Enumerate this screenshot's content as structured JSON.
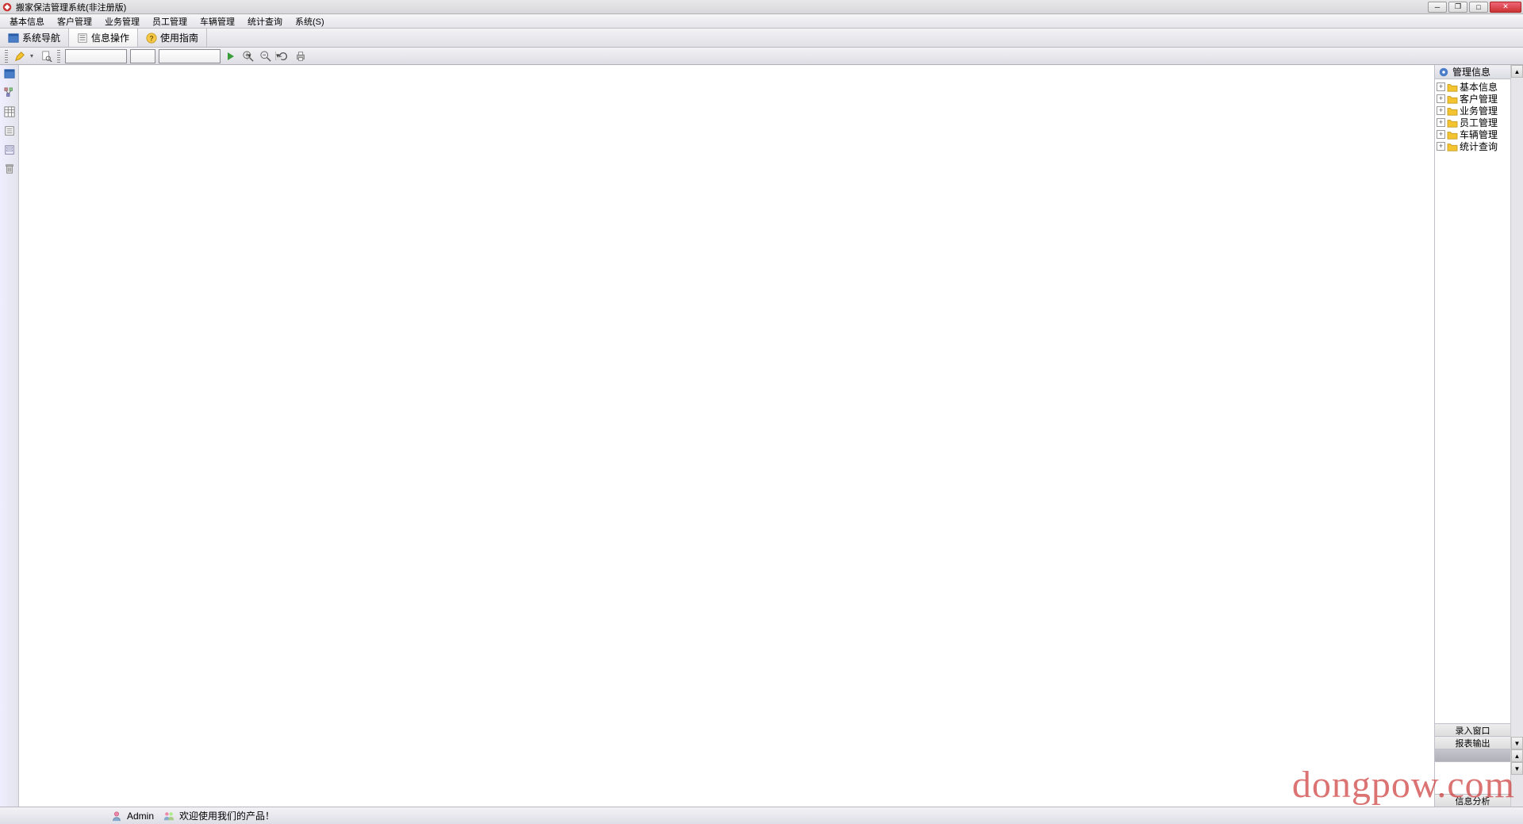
{
  "titlebar": {
    "title": "搬家保洁管理系统(非注册版)"
  },
  "menubar": {
    "items": [
      "基本信息",
      "客户管理",
      "业务管理",
      "员工管理",
      "车辆管理",
      "统计查询",
      "系统(S)"
    ]
  },
  "tabs": {
    "items": [
      {
        "label": "系统导航",
        "icon": "window-icon"
      },
      {
        "label": "信息操作",
        "icon": "info-icon"
      },
      {
        "label": "使用指南",
        "icon": "help-icon"
      }
    ]
  },
  "toolbar2": {
    "combo1_value": "",
    "combo2_value": "",
    "combo3_value": ""
  },
  "left_iconbar": {
    "items": [
      "window-blue-icon",
      "tree-icon",
      "grid-icon",
      "list-icon",
      "form-icon",
      "delete-icon"
    ]
  },
  "right_panel": {
    "header": "管理信息",
    "tree": [
      "基本信息",
      "客户管理",
      "业务管理",
      "员工管理",
      "车辆管理",
      "统计查询"
    ],
    "bottom_tabs": [
      "录入窗口",
      "报表输出"
    ],
    "footer": "信息分析"
  },
  "statusbar": {
    "user": "Admin",
    "welcome": "欢迎使用我们的产品！"
  },
  "watermark": "dongpow.com"
}
